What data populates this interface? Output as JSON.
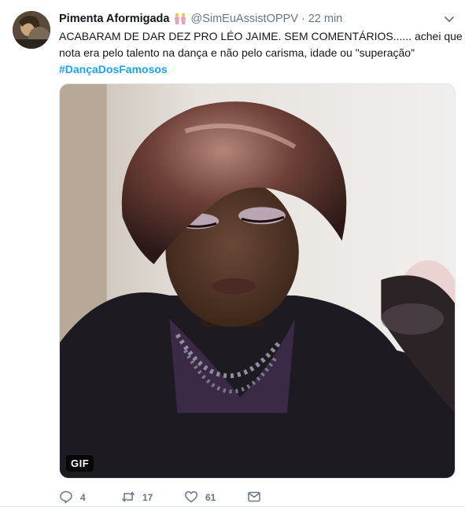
{
  "tweet": {
    "display_name": "Pimenta Aformigada",
    "handle": "@SimEuAssistOPPV",
    "separator": "·",
    "time": "22 min",
    "text_line1": "ACABARAM DE DAR DEZ PRO LÉO JAIME. SEM COMENTÁRIOS...... achei que a",
    "text_line2": "nota era pelo talento na dança e não pelo carisma, idade ou \"superação\"",
    "hashtag": "#DançaDosFamosos",
    "media_badge": "GIF"
  },
  "actions": {
    "reply_count": "4",
    "retweet_count": "17",
    "like_count": "61"
  },
  "icons": {
    "name_emoji": "dancers-emoji-icon",
    "caret": "chevron-down-icon",
    "reply": "reply-icon",
    "retweet": "retweet-icon",
    "like": "heart-icon",
    "dm": "envelope-icon"
  },
  "colors": {
    "link": "#1da1f2",
    "muted": "#657786",
    "text": "#14171a"
  }
}
